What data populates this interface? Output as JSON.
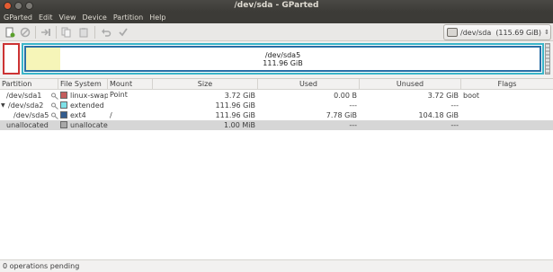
{
  "window": {
    "title": "/dev/sda - GParted"
  },
  "menu": {
    "items": [
      "GParted",
      "Edit",
      "View",
      "Device",
      "Partition",
      "Help"
    ]
  },
  "toolbar": {
    "icons": [
      "new-icon",
      "delete-icon",
      "resize-move-icon",
      "copy-icon",
      "paste-icon",
      "undo-icon",
      "apply-icon"
    ]
  },
  "device_selector": {
    "name": "/dev/sda",
    "size": "(115.69 GiB)"
  },
  "disk_map": {
    "partition_label": "/dev/sda5",
    "partition_size": "111.96 GiB"
  },
  "table": {
    "headers": [
      "Partition",
      "File System",
      "Mount Point",
      "Size",
      "Used",
      "Unused",
      "Flags"
    ],
    "rows": [
      {
        "partition": "/dev/sda1",
        "fs": "linux-swap",
        "fs_color": "#c55d5d",
        "mount": "",
        "size": "3.72 GiB",
        "used": "0.00 B",
        "unused": "3.72 GiB",
        "flags": "boot",
        "lock": true
      },
      {
        "partition": "/dev/sda2",
        "fs": "extended",
        "fs_color": "#7fe1e8",
        "mount": "",
        "size": "111.96 GiB",
        "used": "---",
        "unused": "---",
        "flags": "",
        "lock": true
      },
      {
        "partition": "/dev/sda5",
        "fs": "ext4",
        "fs_color": "#345d8f",
        "mount": "/",
        "size": "111.96 GiB",
        "used": "7.78 GiB",
        "unused": "104.18 GiB",
        "flags": "",
        "lock": true
      },
      {
        "partition": "unallocated",
        "fs": "unallocated",
        "fs_color": "#a8a8a8",
        "mount": "",
        "size": "1.00 MiB",
        "used": "---",
        "unused": "---",
        "flags": "",
        "lock": false
      }
    ]
  },
  "status": {
    "text": "0 operations pending"
  }
}
